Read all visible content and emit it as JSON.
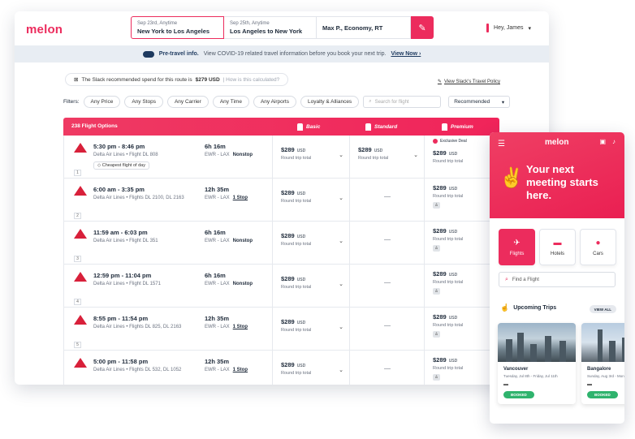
{
  "app": {
    "logo": "melon"
  },
  "search": {
    "leg1_date": "Sep 23rd, Anytime",
    "leg1_route": "New York to Los Angeles",
    "leg2_date": "Sep 25th, Anytime",
    "leg2_route": "Los Angeles to New York",
    "options": "Max P., Economy, RT",
    "edit_icon": "edit-icon"
  },
  "user": {
    "greeting": "Hey, James"
  },
  "banner": {
    "title": "Pre-travel info.",
    "text": "View COVID-19 related travel information before you book your next trip.",
    "link": "View Now ›"
  },
  "recommend": {
    "text": "The Slack recommended spend for this route is",
    "amount": "$279 USD",
    "question": "| How is this calculated?"
  },
  "policy_link": "View Slack's Travel Policy",
  "filters": {
    "label": "Filters:",
    "chips": [
      "Any Price",
      "Any Stops",
      "Any Carrier",
      "Any Time",
      "Any Airports",
      "Loyalty & Alliances"
    ],
    "search_placeholder": "Search for flight",
    "sort": "Recommended"
  },
  "table": {
    "count_label": "238 Flight Options",
    "col_basic": "Basic",
    "col_standard": "Standard",
    "col_premium": "Premium"
  },
  "flights": [
    {
      "index": "1",
      "time": "5:30 pm - 8:46 pm",
      "airline": "Delta Air Lines • Flight DL 808",
      "tag": "Cheapest flight of day",
      "duration": "6h 16m",
      "route": "EWR - LAX",
      "stops": "Nonstop",
      "stops_link": false,
      "basic": "$289",
      "standard": "$289",
      "premium": "$289",
      "deal": "Exclusive Deal"
    },
    {
      "index": "2",
      "time": "6:00 am - 3:35 pm",
      "airline": "Delta Air Lines • Flights DL 2100, DL 2163",
      "tag": "",
      "duration": "12h 35m",
      "route": "EWR - LAX",
      "stops": "1 Stop",
      "stops_link": true,
      "basic": "$289",
      "standard": "",
      "premium": "$289",
      "deal": ""
    },
    {
      "index": "3",
      "time": "11:59 am - 6:03 pm",
      "airline": "Delta Air Lines • Flight DL 351",
      "tag": "",
      "duration": "6h 16m",
      "route": "EWR - LAX",
      "stops": "Nonstop",
      "stops_link": false,
      "basic": "$289",
      "standard": "",
      "premium": "$289",
      "deal": ""
    },
    {
      "index": "4",
      "time": "12:59 pm - 11:04 pm",
      "airline": "Delta Air Lines • Flight DL 1571",
      "tag": "",
      "duration": "6h 16m",
      "route": "EWR - LAX",
      "stops": "Nonstop",
      "stops_link": false,
      "basic": "$289",
      "standard": "",
      "premium": "$289",
      "deal": ""
    },
    {
      "index": "5",
      "time": "8:55 pm - 11:54 pm",
      "airline": "Delta Air Lines • Flights DL 825, DL 2163",
      "tag": "",
      "duration": "12h 35m",
      "route": "EWR - LAX",
      "stops": "1 Stop",
      "stops_link": true,
      "basic": "$289",
      "standard": "",
      "premium": "$289",
      "deal": ""
    },
    {
      "index": "6",
      "time": "5:00 pm - 11:58 pm",
      "airline": "Delta Air Lines • Flights DL 532, DL 1052",
      "tag": "",
      "duration": "12h 35m",
      "route": "EWR - LAX",
      "stops": "1 Stop",
      "stops_link": true,
      "basic": "$289",
      "standard": "",
      "premium": "$289",
      "deal": ""
    }
  ],
  "price_meta": {
    "currency": "USD",
    "round_trip": "Round trip total"
  },
  "mobile": {
    "logo": "melon",
    "headline": "Your next meeting starts here.",
    "tabs": [
      {
        "label": "Flights",
        "icon": "plane-icon"
      },
      {
        "label": "Hotels",
        "icon": "bed-icon"
      },
      {
        "label": "Cars",
        "icon": "car-icon"
      }
    ],
    "find_placeholder": "Find a Flight",
    "upcoming": "Upcoming Trips",
    "view_all": "VIEW ALL",
    "trips": [
      {
        "city": "Vancouver",
        "dates": "Tuesday, Jul 8th - Friday, Jul 11th",
        "status": "BOOKED"
      },
      {
        "city": "Bangalore",
        "dates": "Sunday, Aug 3rd - Mon",
        "status": "BOOKED"
      }
    ]
  },
  "colors": {
    "accent": "#ec2c5d",
    "delta": "#d8203a",
    "booked": "#2fb36d"
  }
}
